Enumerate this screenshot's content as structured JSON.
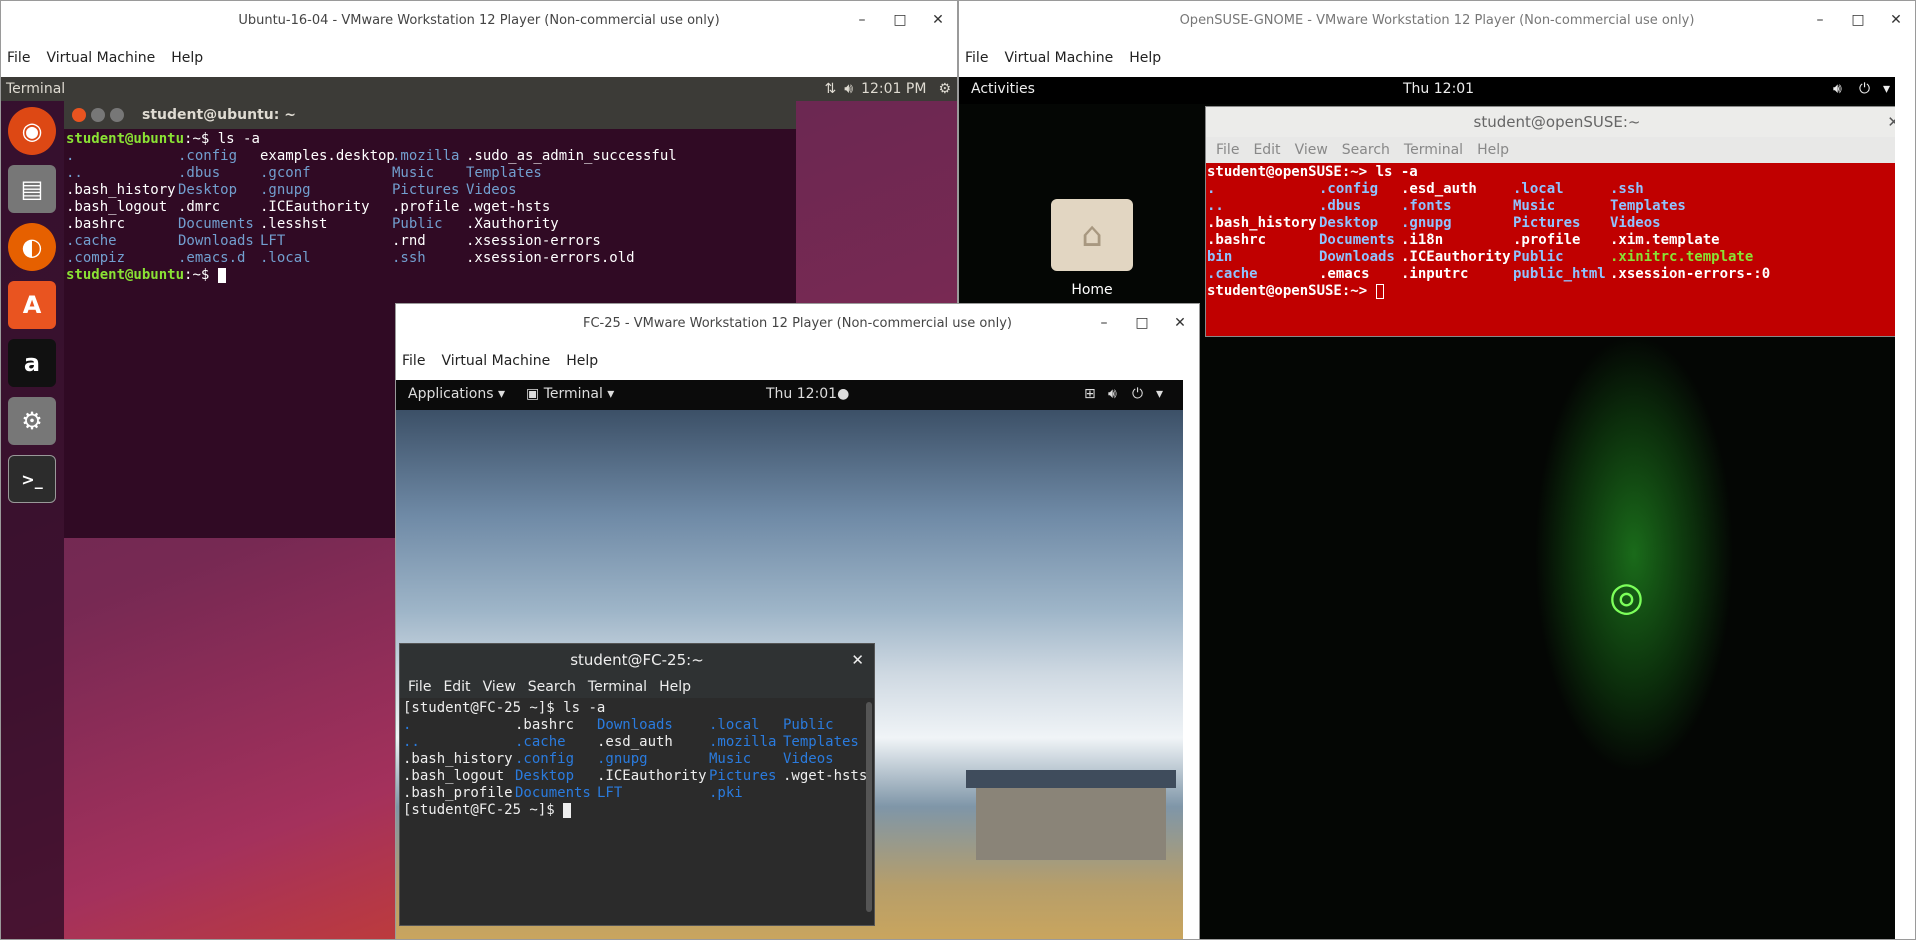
{
  "ubuntu_vm": {
    "title": "Ubuntu-16-04 - VMware Workstation 12 Player (Non-commercial use only)",
    "menu": [
      "File",
      "Virtual Machine",
      "Help"
    ],
    "topbar": {
      "app": "Terminal",
      "time": "12:01 PM"
    },
    "terminal": {
      "title": "student@ubuntu: ~",
      "prompt": "student@ubuntu",
      "prompt_suffix": ":~$ ",
      "command": "ls -a",
      "rows": [
        [
          ".",
          ".config",
          "examples.desktop",
          ".mozilla",
          ".sudo_as_admin_successful"
        ],
        [
          "..",
          ".dbus",
          ".gconf",
          "Music",
          "Templates"
        ],
        [
          ".bash_history",
          "Desktop",
          ".gnupg",
          "Pictures",
          "Videos"
        ],
        [
          ".bash_logout",
          ".dmrc",
          ".ICEauthority",
          ".profile",
          ".wget-hsts"
        ],
        [
          ".bashrc",
          "Documents",
          ".lesshst",
          "Public",
          ".Xauthority"
        ],
        [
          ".cache",
          "Downloads",
          "LFT",
          ".rnd",
          ".xsession-errors"
        ],
        [
          ".compiz",
          ".emacs.d",
          ".local",
          ".ssh",
          ".xsession-errors.old"
        ]
      ]
    }
  },
  "opensuse_vm": {
    "title": "OpenSUSE-GNOME - VMware Workstation 12 Player (Non-commercial use only)",
    "menu": [
      "File",
      "Virtual Machine",
      "Help"
    ],
    "topbar": {
      "activities": "Activities",
      "time": "Thu 12:01"
    },
    "desktop_icon": "Home",
    "terminal": {
      "title": "student@openSUSE:~",
      "menu": [
        "File",
        "Edit",
        "View",
        "Search",
        "Terminal",
        "Help"
      ],
      "prompt": "student@openSUSE:~> ",
      "command": "ls -a",
      "rows": [
        [
          ".",
          ".config",
          ".esd_auth",
          ".local",
          ".ssh"
        ],
        [
          "..",
          ".dbus",
          ".fonts",
          "Music",
          "Templates"
        ],
        [
          ".bash_history",
          "Desktop",
          ".gnupg",
          "Pictures",
          "Videos"
        ],
        [
          ".bashrc",
          "Documents",
          ".i18n",
          ".profile",
          ".xim.template"
        ],
        [
          "bin",
          "Downloads",
          ".ICEauthority",
          "Public",
          ".xinitrc.template"
        ],
        [
          ".cache",
          ".emacs",
          ".inputrc",
          "public_html",
          ".xsession-errors-:0"
        ]
      ]
    }
  },
  "fedora_vm": {
    "title": "FC-25 - VMware Workstation 12 Player (Non-commercial use only)",
    "menu": [
      "File",
      "Virtual Machine",
      "Help"
    ],
    "topbar": {
      "applications": "Applications",
      "terminal": "Terminal",
      "time": "Thu 12:01"
    },
    "terminal": {
      "title": "student@FC-25:~",
      "menu": [
        "File",
        "Edit",
        "View",
        "Search",
        "Terminal",
        "Help"
      ],
      "prompt": "[student@FC-25 ~]$ ",
      "command": "ls -a",
      "rows": [
        [
          ".",
          ".bashrc",
          "Downloads",
          ".local",
          "Public"
        ],
        [
          "..",
          ".cache",
          ".esd_auth",
          ".mozilla",
          "Templates"
        ],
        [
          ".bash_history",
          ".config",
          ".gnupg",
          "Music",
          "Videos"
        ],
        [
          ".bash_logout",
          "Desktop",
          ".ICEauthority",
          "Pictures",
          ".wget-hsts"
        ],
        [
          ".bash_profile",
          "Documents",
          "LFT",
          ".pki",
          ""
        ]
      ]
    }
  },
  "colors": {
    "ubuntu_term_bg": "#300a24",
    "ubuntu_dir": "#729fcf",
    "ubuntu_prompt": "#8ae234",
    "suse_term_bg": "#c00000",
    "fedora_dir": "#2a7bde"
  }
}
